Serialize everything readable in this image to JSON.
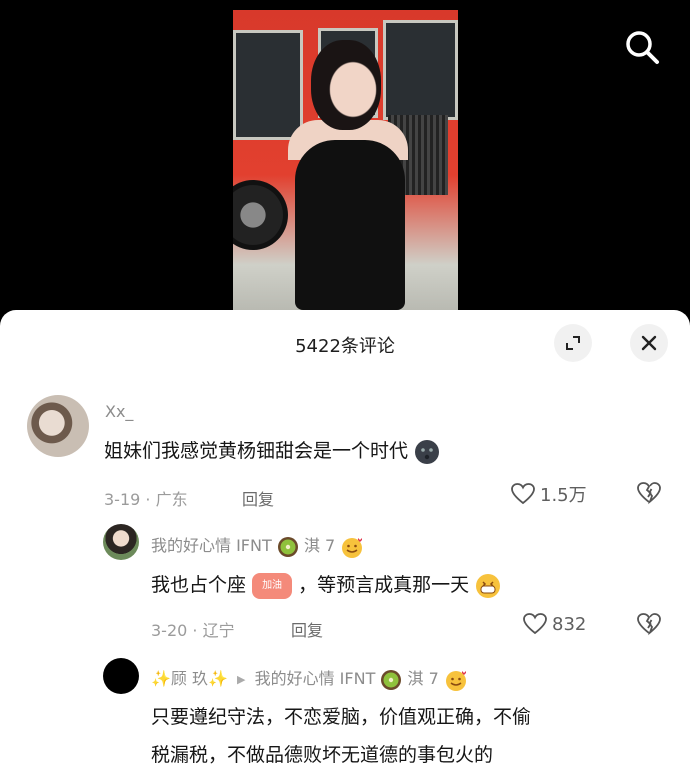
{
  "header": {
    "search_icon": "search-icon"
  },
  "sheet": {
    "title": "5422条评论",
    "expand_icon": "expand-icon",
    "close_icon": "close-icon"
  },
  "comments": [
    {
      "username": "Xx_",
      "text": "姐妹们我感觉黄杨钿甜会是一个时代",
      "date_location": "3-19 · 广东",
      "reply_label": "回复",
      "likes": "1.5万"
    },
    {
      "username": "我的好心情 IFNT",
      "username_suffix": "淇 7",
      "text_before": "我也占个座",
      "sticker_label": "加油",
      "text_after": "，等预言成真那一天",
      "date_location": "3-20 · 辽宁",
      "reply_label": "回复",
      "likes": "832"
    },
    {
      "username": "✨顾 玖✨",
      "reply_to": "我的好心情 IFNT",
      "reply_to_suffix": "淇 7",
      "text_line1": "只要遵纪守法，不恋爱脑，价值观正确，不偷",
      "text_line2": "税漏税，不做品德败坏无道德的事包火的"
    }
  ],
  "colors": {
    "sheet_bg": "#ffffff",
    "page_bg": "#000000",
    "muted_text": "#8c8c8c",
    "bus_red": "#e2402f"
  }
}
